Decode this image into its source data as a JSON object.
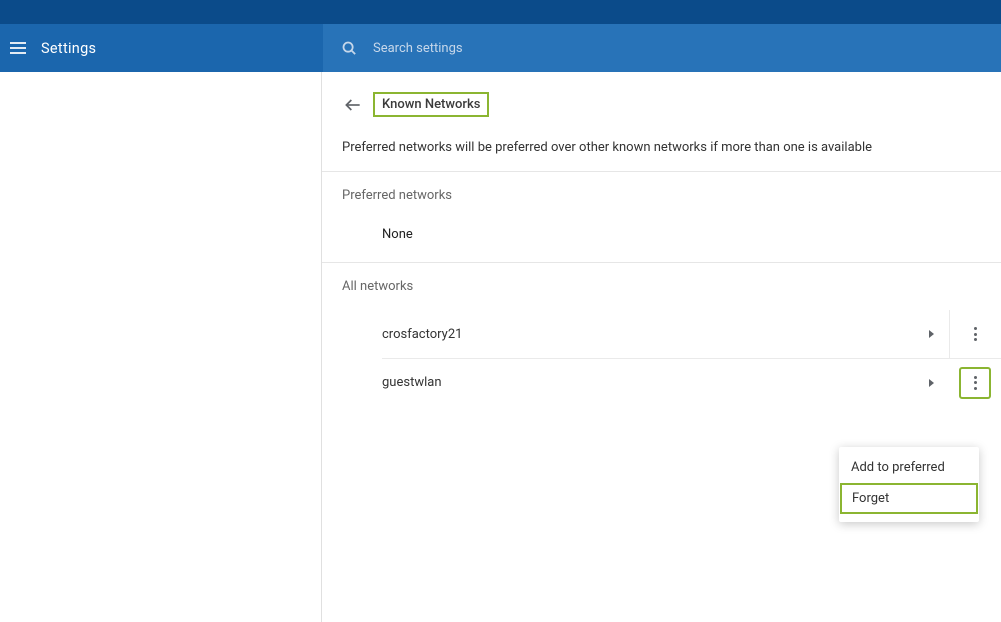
{
  "header": {
    "settings": "Settings",
    "searchPlaceholder": "Search settings"
  },
  "page": {
    "title": "Known Networks",
    "desc": "Preferred networks will be preferred over other known networks if more than one is available"
  },
  "preferred": {
    "section": "Preferred networks",
    "none": "None"
  },
  "allnet": {
    "section": "All networks",
    "items": [
      {
        "name": "crosfactory21"
      },
      {
        "name": "guestwlan"
      }
    ]
  },
  "menu": {
    "addPreferred": "Add to preferred",
    "forget": "Forget"
  }
}
